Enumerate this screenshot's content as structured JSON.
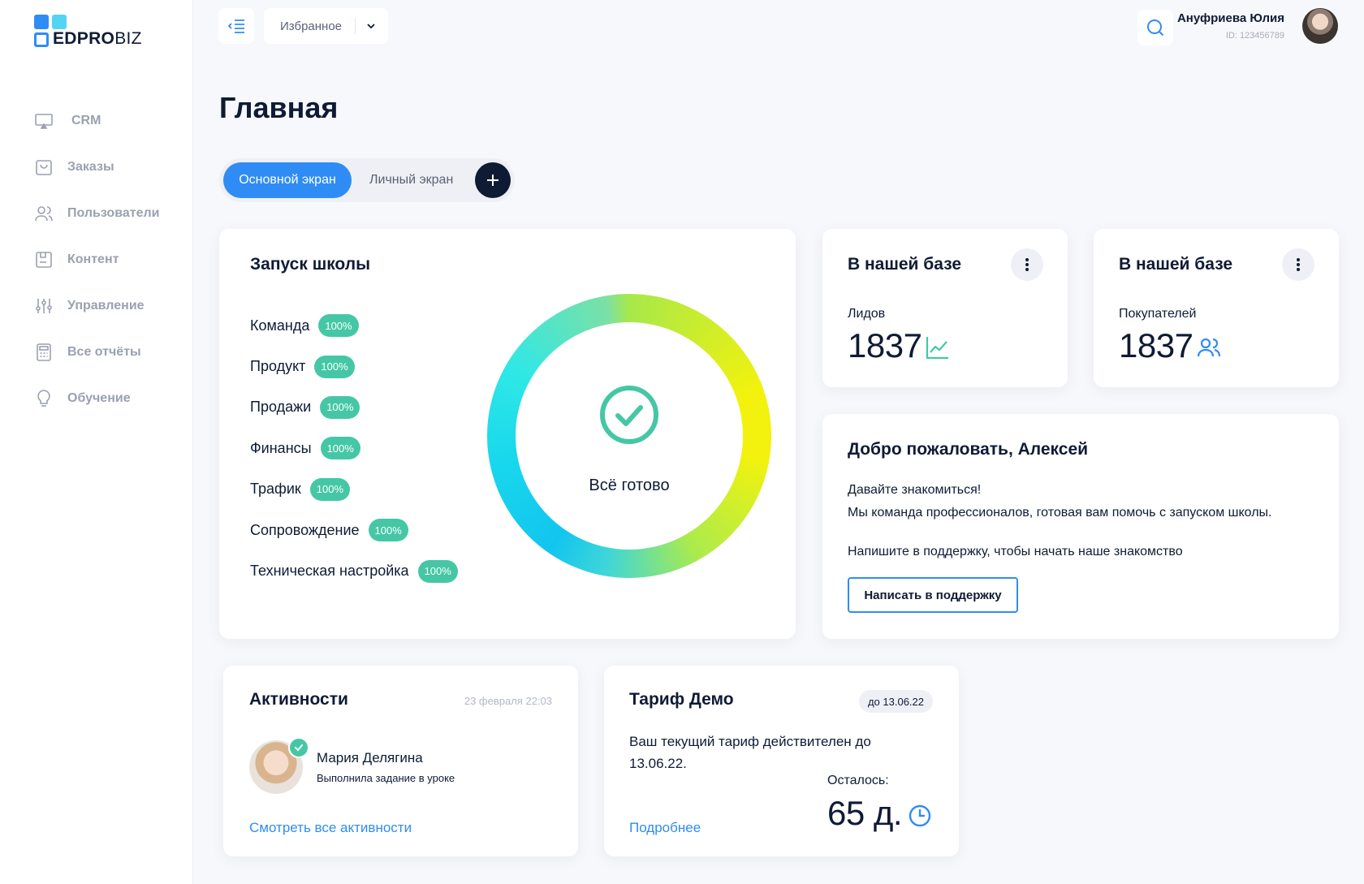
{
  "brand": {
    "logo_main": "EDPRO",
    "logo_light": "BIZ"
  },
  "sidebar": {
    "items": [
      {
        "label": "CRM",
        "icon": "monitor-icon"
      },
      {
        "label": "Заказы",
        "icon": "shopping-bag-icon"
      },
      {
        "label": "Пользователи",
        "icon": "users-icon"
      },
      {
        "label": "Контент",
        "icon": "content-icon"
      },
      {
        "label": "Управление",
        "icon": "sliders-icon"
      },
      {
        "label": "Все отчёты",
        "icon": "calculator-icon"
      },
      {
        "label": "Обучение",
        "icon": "lightbulb-icon"
      }
    ]
  },
  "topbar": {
    "favorites_label": "Избранное",
    "user_name": "Ануфриева Юлия",
    "user_id": "ID: 123456789"
  },
  "page": {
    "title": "Главная"
  },
  "tabs": {
    "active": "Основной экран",
    "inactive": "Личный экран"
  },
  "school": {
    "title": "Запуск школы",
    "steps": [
      {
        "label": "Команда",
        "value": "100%"
      },
      {
        "label": "Продукт",
        "value": "100%"
      },
      {
        "label": "Продажи",
        "value": "100%"
      },
      {
        "label": "Финансы",
        "value": "100%"
      },
      {
        "label": "Трафик",
        "value": "100%"
      },
      {
        "label": "Сопровождение",
        "value": "100%"
      },
      {
        "label": "Техническая настройка",
        "value": "100%"
      }
    ],
    "status": "Всё готово",
    "progress": 1.0
  },
  "stats": [
    {
      "title": "В нашей базе",
      "label": "Лидов",
      "value": "1837",
      "icon": "trend-chart-icon"
    },
    {
      "title": "В нашей базе",
      "label": "Покупателей",
      "value": "1837",
      "icon": "users-icon"
    }
  ],
  "welcome": {
    "title": "Добро пожаловать, Алексей",
    "line1": "Давайте знакомиться!",
    "line2": "Мы команда профессионалов, готовая вам помочь с запуском школы.",
    "line3": "Напишите в поддержку, чтобы начать наше знакомство",
    "button": "Написать в поддержку"
  },
  "activity": {
    "title": "Активности",
    "date": "23 февраля 22:03",
    "person": "Мария Делягина",
    "action": "Выполнила задание в уроке",
    "link": "Смотреть все активности"
  },
  "tariff": {
    "title": "Тариф Демо",
    "badge": "до 13.06.22",
    "text": "Ваш текущий тариф действителен до 13.06.22.",
    "remaining_label": "Осталось:",
    "remaining_value": "65 д.",
    "link": "Подробнее"
  },
  "colors": {
    "accent": "#2f8cf5",
    "success": "#45c7a5",
    "dark": "#0f1b35",
    "muted": "#9aa1b0"
  }
}
